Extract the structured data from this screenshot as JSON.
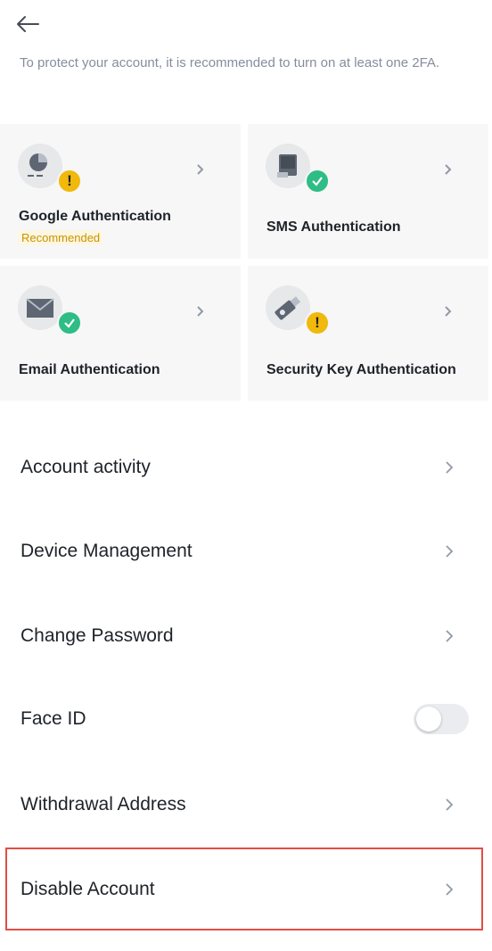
{
  "header": {
    "back_icon": "arrow-left-icon",
    "intro": "To protect your account, it is recommended to turn on at least one 2FA."
  },
  "two_fa": {
    "cards": [
      {
        "label": "Google Authentication",
        "tag": "Recommended",
        "icon": "authenticator-icon",
        "status": "warning",
        "status_icon": "exclamation-icon"
      },
      {
        "label": "SMS Authentication",
        "icon": "phone-icon",
        "status": "enabled",
        "status_icon": "check-icon"
      },
      {
        "label": "Email Authentication",
        "icon": "envelope-icon",
        "status": "enabled",
        "status_icon": "check-icon"
      },
      {
        "label": "Security Key Authentication",
        "icon": "usb-key-icon",
        "status": "warning",
        "status_icon": "exclamation-icon"
      }
    ]
  },
  "settings": {
    "account_activity": "Account activity",
    "device_management": "Device Management",
    "change_password": "Change Password",
    "face_id": "Face ID",
    "face_id_enabled": false,
    "withdrawal_address": "Withdrawal Address",
    "disable_account": "Disable Account"
  },
  "colors": {
    "warning": "#f0b90b",
    "success": "#2ebd85",
    "highlight": "#e24e44",
    "tag_text": "#c99400"
  }
}
